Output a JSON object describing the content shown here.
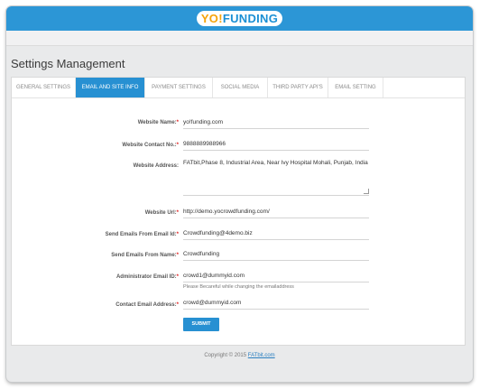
{
  "brand": {
    "yo": "YO!",
    "funding": "FUNDING"
  },
  "page_title": "Settings Management",
  "tabs": [
    {
      "label": "GENERAL SETTINGS",
      "active": false
    },
    {
      "label": "EMAIL AND SITE INFO",
      "active": true
    },
    {
      "label": "PAYMENT SETTINGS",
      "active": false
    },
    {
      "label": "SOCIAL MEDIA",
      "active": false
    },
    {
      "label": "THIRD PARTY API'S",
      "active": false
    },
    {
      "label": "EMAIL SETTING",
      "active": false
    }
  ],
  "form": {
    "website_name": {
      "label": "Website Name:",
      "value": "yo!funding.com"
    },
    "website_contact": {
      "label": "Website Contact No.:",
      "value": "9888889988966"
    },
    "website_address": {
      "label": "Website Address:",
      "value": "FATbit,Phase 8, Industrial Area, Near Ivy Hospital Mohali, Punjab, India"
    },
    "website_url": {
      "label": "Website Url:",
      "value": "http://demo.yocrowdfunding.com/"
    },
    "send_from_email": {
      "label": "Send Emails From Email Id:",
      "value": "Crowdfunding@4demo.biz"
    },
    "send_from_name": {
      "label": "Send Emails From Name:",
      "value": "Crowdfunding"
    },
    "admin_email": {
      "label": "Administrator Email ID:",
      "value": "crowd1@dummyid.com",
      "hint": "Please Becareful while changing the emailaddress"
    },
    "contact_email": {
      "label": "Contact Email Address:",
      "value": "crowd@dummyid.com"
    },
    "submit_label": "SUBMIT"
  },
  "footer": {
    "prefix": "Copyright © 2015 ",
    "link": "FATbit.com"
  },
  "colors": {
    "primary": "#2c96d6",
    "required": "#e02020",
    "logo_orange": "#f5a30a"
  }
}
